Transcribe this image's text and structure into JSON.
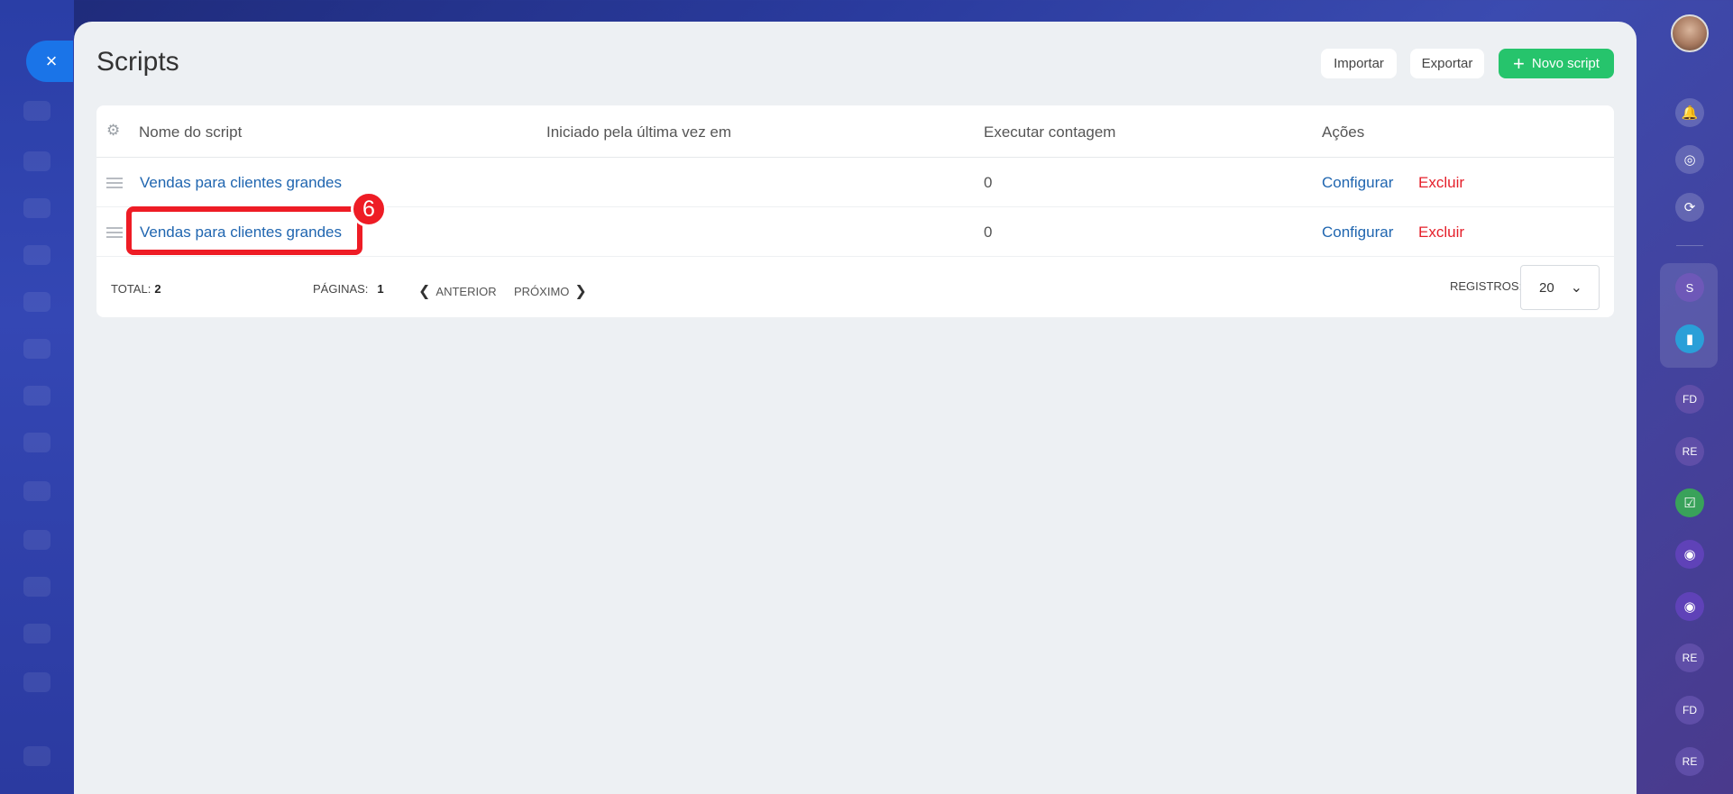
{
  "page": {
    "title": "Scripts",
    "close_icon": "×"
  },
  "toolbar": {
    "import_label": "Importar",
    "export_label": "Exportar",
    "new_label": "Novo script",
    "new_icon": "+"
  },
  "table": {
    "columns": [
      "Nome do script",
      "Iniciado pela última vez em",
      "Executar contagem",
      "Ações"
    ],
    "rows": [
      {
        "name": "Vendas para clientes grandes",
        "last_started": "",
        "run_count": "0",
        "configure": "Configurar",
        "delete": "Excluir"
      },
      {
        "name": "Vendas para clientes grandes",
        "last_started": "",
        "run_count": "0",
        "configure": "Configurar",
        "delete": "Excluir"
      }
    ]
  },
  "footer": {
    "total_label": "TOTAL:",
    "total_value": "2",
    "pages_label": "PÁGINAS:",
    "pages_value": "1",
    "prev_label": "ANTERIOR",
    "next_label": "PRÓXIMO",
    "records_label": "REGISTROS:",
    "records_value": "20"
  },
  "annotation": {
    "badge_number": "6",
    "color": "#ee1c25"
  },
  "rail": {
    "s_label": "S",
    "fd_label": "FD",
    "re_label": "RE"
  },
  "colors": {
    "primary_link": "#2066b0",
    "danger": "#e5202b",
    "success": "#26c46c",
    "close_button": "#1a74e8"
  }
}
